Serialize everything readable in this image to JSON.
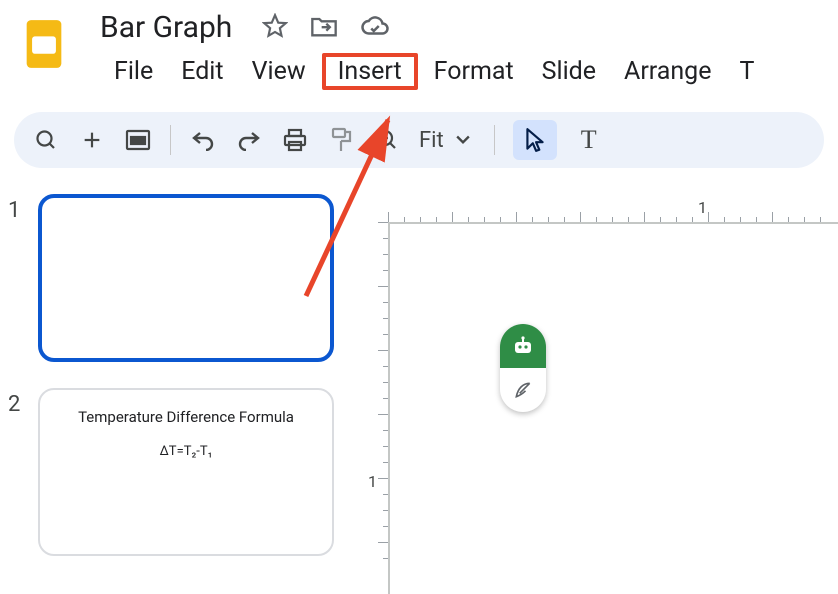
{
  "doc": {
    "title": "Bar Graph"
  },
  "menu": {
    "file": "File",
    "edit": "Edit",
    "view": "View",
    "insert": "Insert",
    "format": "Format",
    "slide": "Slide",
    "arrange": "Arrange"
  },
  "toolbar": {
    "fit_label": "Fit"
  },
  "thumbs": {
    "n1": "1",
    "n2": "2",
    "slide2_title": "Temperature Difference Formula",
    "slide2_formula": "ΔT=T₂-T₁"
  },
  "ruler": {
    "h1": "1",
    "v1": "1"
  },
  "highlight_target": "insert"
}
